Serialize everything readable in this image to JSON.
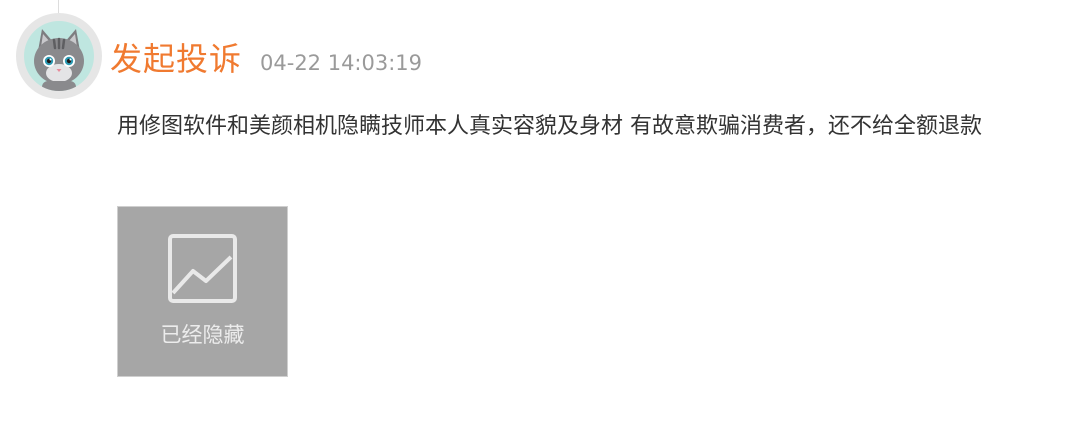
{
  "event": {
    "title": "发起投诉",
    "timestamp": "04-22 14:03:19",
    "title_color": "#f07a30"
  },
  "complaint": {
    "text": "用修图软件和美颜相机隐瞒技师本人真实容貌及身材 有故意欺骗消费者，还不给全额退款"
  },
  "attachment": {
    "icon": "image-placeholder-icon",
    "label": "已经隐藏"
  },
  "avatar": {
    "icon": "cat-avatar"
  }
}
